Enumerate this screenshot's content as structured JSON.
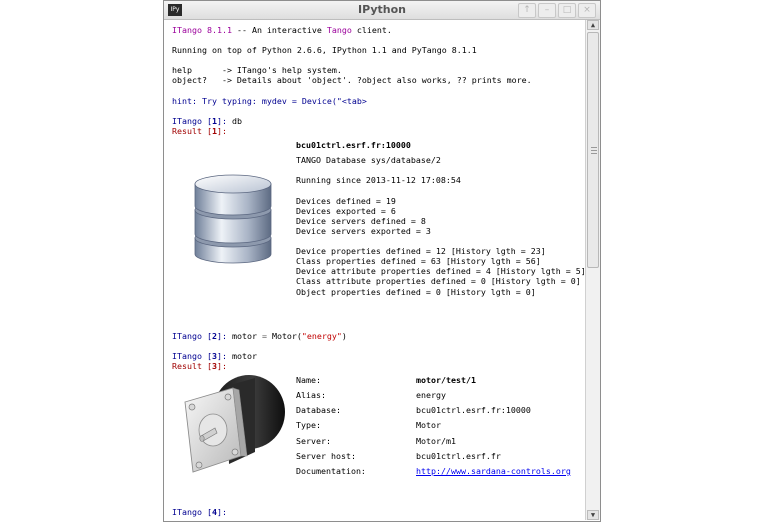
{
  "window": {
    "title": "IPython",
    "app_icon_text": "IPy",
    "buttons": [
      "↑",
      "–",
      "□",
      "×"
    ]
  },
  "banner": {
    "line1": {
      "itango": "ITango",
      "version": "8.1.1",
      "sep": " -- An interactive ",
      "tango": "Tango",
      "rest": " client."
    },
    "line2": "Running on top of Python 2.6.6, IPython 1.1 and PyTango 8.1.1",
    "help1": "help      -> ITango's help system.",
    "help2": "object?   -> Details about 'object'. ?object also works, ?? prints more.",
    "hint": "hint: Try typing: mydev = Device(\"<tab>"
  },
  "cells": {
    "in1": {
      "prompt_word": "ITango [",
      "num": "1",
      "end": "]: ",
      "code": "db"
    },
    "out1": {
      "prompt_word": "Result [",
      "num": "1",
      "end": "]:"
    },
    "db": {
      "host": "bcu01ctrl.esrf.fr:10000",
      "name": "TANGO Database sys/database/2",
      "running": "Running since 2013-11-12 17:08:54",
      "lines": [
        "Devices defined = 19",
        "Devices exported = 6",
        "Device servers defined = 8",
        "Device servers exported = 3"
      ],
      "props": [
        "Device properties defined = 12 [History lgth = 23]",
        "Class properties defined = 63 [History lgth = 56]",
        "Device attribute properties defined = 4 [History lgth = 5]",
        "Class attribute properties defined = 0 [History lgth = 0]",
        "Object properties defined = 0 [History lgth = 0]"
      ]
    },
    "in2": {
      "prompt_word": "ITango [",
      "num": "2",
      "end": "]: ",
      "code_a": "motor ",
      "eq": "=",
      "code_b": " Motor(",
      "str": "\"energy\"",
      "code_c": ")"
    },
    "in3": {
      "prompt_word": "ITango [",
      "num": "3",
      "end": "]: ",
      "code": "motor"
    },
    "out3": {
      "prompt_word": "Result [",
      "num": "3",
      "end": "]:"
    },
    "motor": {
      "name_label": "Name:",
      "name_value": "motor/test/1",
      "alias_label": "Alias:",
      "alias_value": "energy",
      "database_label": "Database:",
      "database_value": "bcu01ctrl.esrf.fr:10000",
      "type_label": "Type:",
      "type_value": "Motor",
      "server_label": "Server:",
      "server_value": "Motor/m1",
      "host_label": "Server host:",
      "host_value": "bcu01ctrl.esrf.fr",
      "doc_label": "Documentation:",
      "doc_value": "http://www.sardana-controls.org"
    },
    "in4": {
      "prompt_word": "ITango [",
      "num": "4",
      "end": "]:"
    }
  },
  "icons": {
    "database": "database-icon",
    "motor": "stepper-motor-icon"
  }
}
